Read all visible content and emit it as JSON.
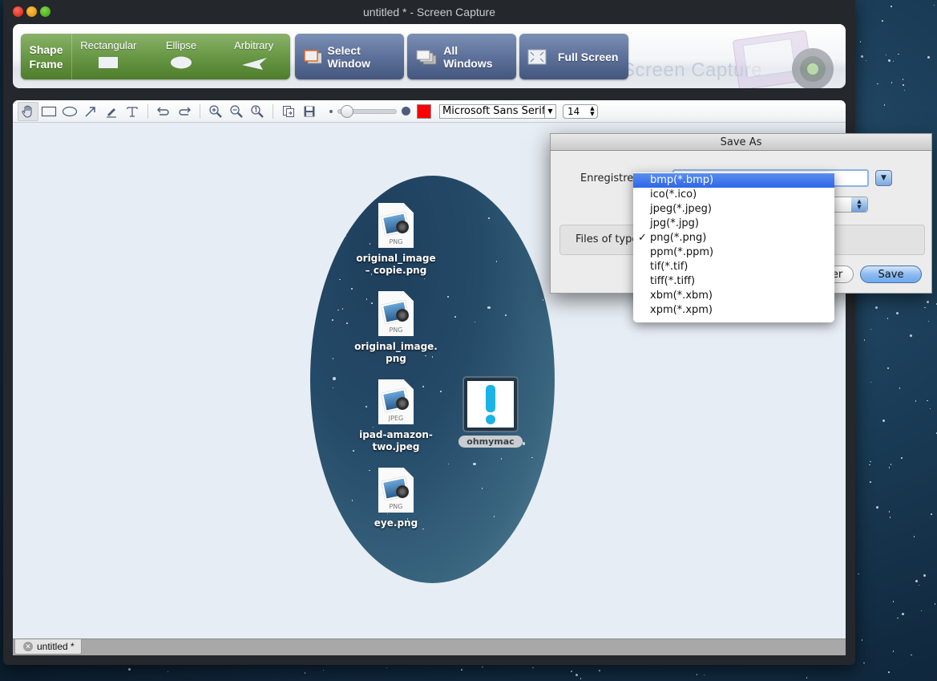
{
  "window": {
    "title": "untitled * - Screen Capture"
  },
  "capture_bar": {
    "shape_frame_label": "Shape\nFrame",
    "shape_options": [
      {
        "label": "Rectangular",
        "icon": "rectangle-shape-icon"
      },
      {
        "label": "Ellipse",
        "icon": "ellipse-shape-icon"
      },
      {
        "label": "Arbitrary",
        "icon": "arbitrary-shape-icon"
      }
    ],
    "buttons": [
      {
        "label": "Select Window",
        "icon": "select-window-icon"
      },
      {
        "label": "All Windows",
        "icon": "all-windows-icon"
      },
      {
        "label": "Full Screen",
        "icon": "full-screen-icon"
      }
    ],
    "brand_watermark": "Screen Capture"
  },
  "toolbar": {
    "tools": [
      "hand-tool",
      "rectangle-tool",
      "ellipse-tool",
      "arrow-tool",
      "pen-tool",
      "text-tool"
    ],
    "active_tool": "hand-tool",
    "history": [
      "undo",
      "redo"
    ],
    "zoom": [
      "zoom-in",
      "zoom-out",
      "zoom-actual"
    ],
    "file": [
      "copy",
      "save"
    ],
    "stroke_slider_value": 0.1,
    "color": "#ff0000",
    "font_family_value": "Microsoft Sans Serif",
    "font_size_value": "14"
  },
  "canvas": {
    "desktop_items": [
      {
        "label": "original_image\n– copie.png",
        "type": "PNG"
      },
      {
        "label": "original_image.\npng",
        "type": "PNG"
      },
      {
        "label": "ipad-amazon-\ntwo.jpeg",
        "type": "JPEG"
      },
      {
        "label": "eye.png",
        "type": "PNG"
      }
    ],
    "app_item": {
      "label": "ohmymac",
      "symbol": "!"
    }
  },
  "tabs": [
    {
      "label": "untitled *"
    }
  ],
  "save_dialog": {
    "title": "Save As",
    "save_as_label": "Enregistrer",
    "files_of_type_label": "Files of type",
    "cancel_label": "Annuler",
    "save_label": "Save"
  },
  "file_type_menu": {
    "highlighted": "bmp(*.bmp)",
    "checked": "png(*.png)",
    "check_glyph": "✓",
    "options": [
      "bmp(*.bmp)",
      "ico(*.ico)",
      "jpeg(*.jpeg)",
      "jpg(*.jpg)",
      "png(*.png)",
      "ppm(*.ppm)",
      "tif(*.tif)",
      "tiff(*.tiff)",
      "xbm(*.xbm)",
      "xpm(*.xpm)"
    ]
  }
}
